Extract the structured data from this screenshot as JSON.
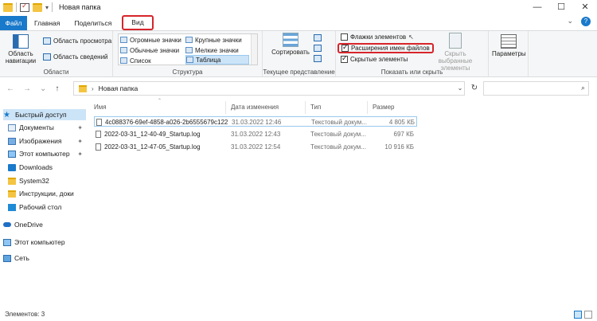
{
  "window": {
    "title": "Новая папка",
    "controls": [
      "—",
      "☐",
      "✕"
    ]
  },
  "tabs": {
    "file": "Файл",
    "home": "Главная",
    "share": "Поделиться",
    "view": "Вид"
  },
  "ribbon": {
    "panes": {
      "nav_pane": "Область навигации",
      "preview_pane": "Область просмотра",
      "details_pane": "Область сведений",
      "group_label": "Области"
    },
    "layout": {
      "items": [
        "Огромные значки",
        "Крупные значки",
        "Обычные значки",
        "Мелкие значки",
        "Список",
        "Таблица"
      ],
      "selected": "Таблица",
      "group_label": "Структура"
    },
    "current_view": {
      "sort": "Сортировать",
      "group_label": "Текущее представление"
    },
    "show_hide": {
      "item_checkboxes": "Флажки элементов",
      "item_checkboxes_checked": false,
      "file_extensions": "Расширения имен файлов",
      "file_extensions_checked": true,
      "hidden_items": "Скрытые элементы",
      "hidden_items_checked": true,
      "hide_selected": "Скрыть выбранные элементы",
      "group_label": "Показать или скрыть"
    },
    "options": "Параметры"
  },
  "address": {
    "path": "Новая папка"
  },
  "sidebar": {
    "items": [
      {
        "label": "Быстрый доступ",
        "icon": "star-icon"
      },
      {
        "label": "Документы",
        "icon": "documents-icon"
      },
      {
        "label": "Изображения",
        "icon": "pictures-icon"
      },
      {
        "label": "Этот компьютер",
        "icon": "computer-icon"
      },
      {
        "label": "Downloads",
        "icon": "download-icon"
      },
      {
        "label": "System32",
        "icon": "folder-icon"
      },
      {
        "label": "Инструкции, доки",
        "icon": "folder-icon"
      },
      {
        "label": "Рабочий стол",
        "icon": "desktop-icon"
      },
      {
        "label": "OneDrive",
        "icon": "cloud-icon"
      },
      {
        "label": "Этот компьютер",
        "icon": "computer-icon"
      },
      {
        "label": "Сеть",
        "icon": "network-icon"
      }
    ]
  },
  "files": {
    "columns": [
      "Имя",
      "Дата изменения",
      "Тип",
      "Размер"
    ],
    "rows": [
      {
        "name": "4c088376-69ef-4858-a026-2b6555679c122...",
        "date": "31.03.2022 12:46",
        "type": "Текстовый докум...",
        "size": "4 805 КБ"
      },
      {
        "name": "2022-03-31_12-40-49_Startup.log",
        "date": "31.03.2022 12:43",
        "type": "Текстовый докум...",
        "size": "697 КБ"
      },
      {
        "name": "2022-03-31_12-47-05_Startup.log",
        "date": "31.03.2022 12:54",
        "type": "Текстовый докум...",
        "size": "10 916 КБ"
      }
    ]
  },
  "status": {
    "count": "Элементов: 3"
  },
  "colors": {
    "accent": "#1979ca",
    "highlight": "#d6252b",
    "selection": "#cce4f7"
  }
}
